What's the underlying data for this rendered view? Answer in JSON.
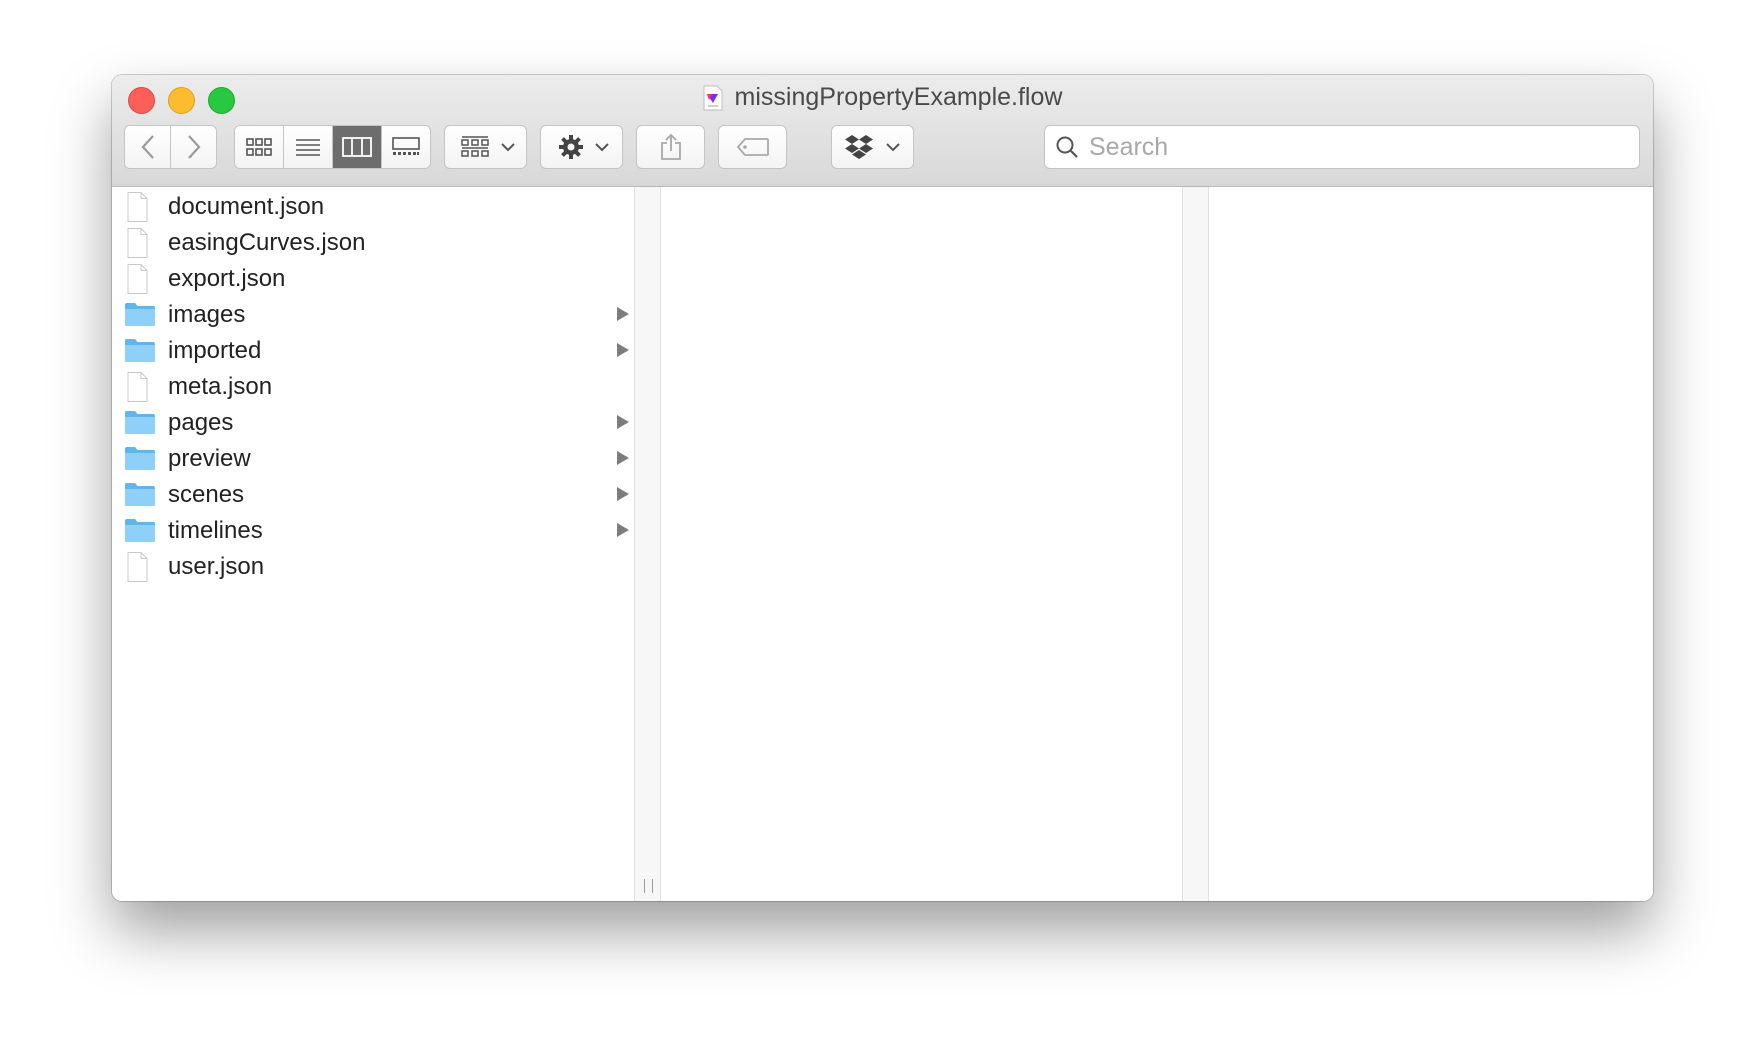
{
  "window": {
    "title": "missingPropertyExample.flow"
  },
  "toolbar": {
    "back_icon": "chevron-left-icon",
    "forward_icon": "chevron-right-icon",
    "view_modes": [
      "icon-view",
      "list-view",
      "column-view",
      "gallery-view"
    ],
    "active_view": "column-view",
    "group_icon": "group-icon",
    "action_icon": "gear-icon",
    "share_icon": "share-icon",
    "tag_icon": "tag-icon",
    "dropbox_icon": "dropbox-icon",
    "search": {
      "placeholder": "Search",
      "value": ""
    }
  },
  "columns": [
    {
      "items": [
        {
          "name": "document.json",
          "kind": "file"
        },
        {
          "name": "easingCurves.json",
          "kind": "file"
        },
        {
          "name": "export.json",
          "kind": "file"
        },
        {
          "name": "images",
          "kind": "folder"
        },
        {
          "name": "imported",
          "kind": "folder"
        },
        {
          "name": "meta.json",
          "kind": "file"
        },
        {
          "name": "pages",
          "kind": "folder"
        },
        {
          "name": "preview",
          "kind": "folder"
        },
        {
          "name": "scenes",
          "kind": "folder"
        },
        {
          "name": "timelines",
          "kind": "folder"
        },
        {
          "name": "user.json",
          "kind": "file"
        }
      ]
    },
    {
      "items": []
    },
    {
      "items": []
    }
  ],
  "colors": {
    "close": "#fc5f57",
    "minimize": "#fdbc2e",
    "maximize": "#28c840",
    "folder": "#6cc4f4",
    "active_segment": "#6d6d6d"
  }
}
